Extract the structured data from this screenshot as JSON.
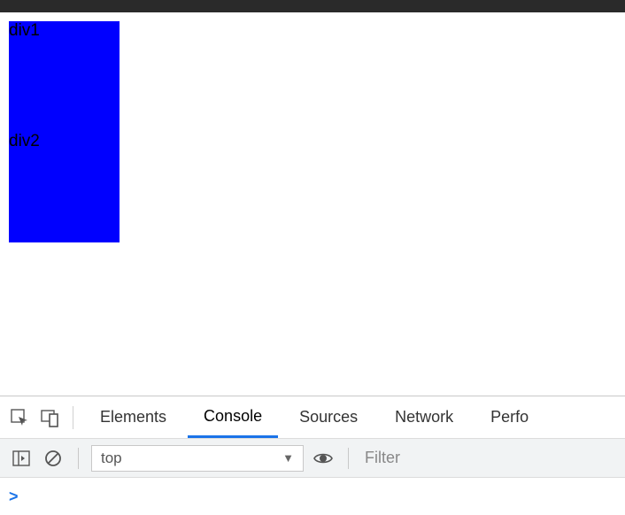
{
  "viewport": {
    "divs": [
      {
        "label": "div1"
      },
      {
        "label": "div2"
      }
    ]
  },
  "devtools": {
    "tabs": {
      "elements": "Elements",
      "console": "Console",
      "sources": "Sources",
      "network": "Network",
      "performance": "Perfo"
    },
    "active_tab": "Console",
    "toolbar": {
      "context": "top",
      "filter_placeholder": "Filter"
    },
    "prompt": ">"
  }
}
